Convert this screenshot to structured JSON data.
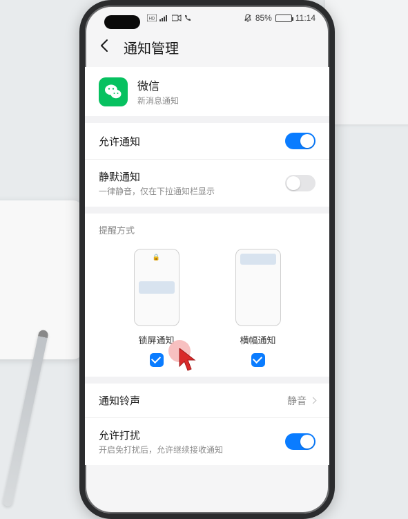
{
  "statusbar": {
    "battery_text": "85%",
    "time": "11:14"
  },
  "header": {
    "title": "通知管理"
  },
  "app": {
    "name": "微信",
    "subtitle": "新消息通知"
  },
  "rows": {
    "allow_notification": {
      "label": "允许通知",
      "on": true
    },
    "silent": {
      "label": "静默通知",
      "sub": "一律静音，仅在下拉通知栏显示",
      "on": false
    },
    "sound": {
      "label": "通知铃声",
      "value": "静音"
    },
    "dnd": {
      "label": "允许打扰",
      "sub": "开启免打扰后，允许继续接收通知",
      "on": true
    }
  },
  "group": {
    "title": "提醒方式",
    "options": {
      "lockscreen": {
        "label": "锁屏通知",
        "checked": true
      },
      "banner": {
        "label": "横幅通知",
        "checked": true
      }
    }
  }
}
